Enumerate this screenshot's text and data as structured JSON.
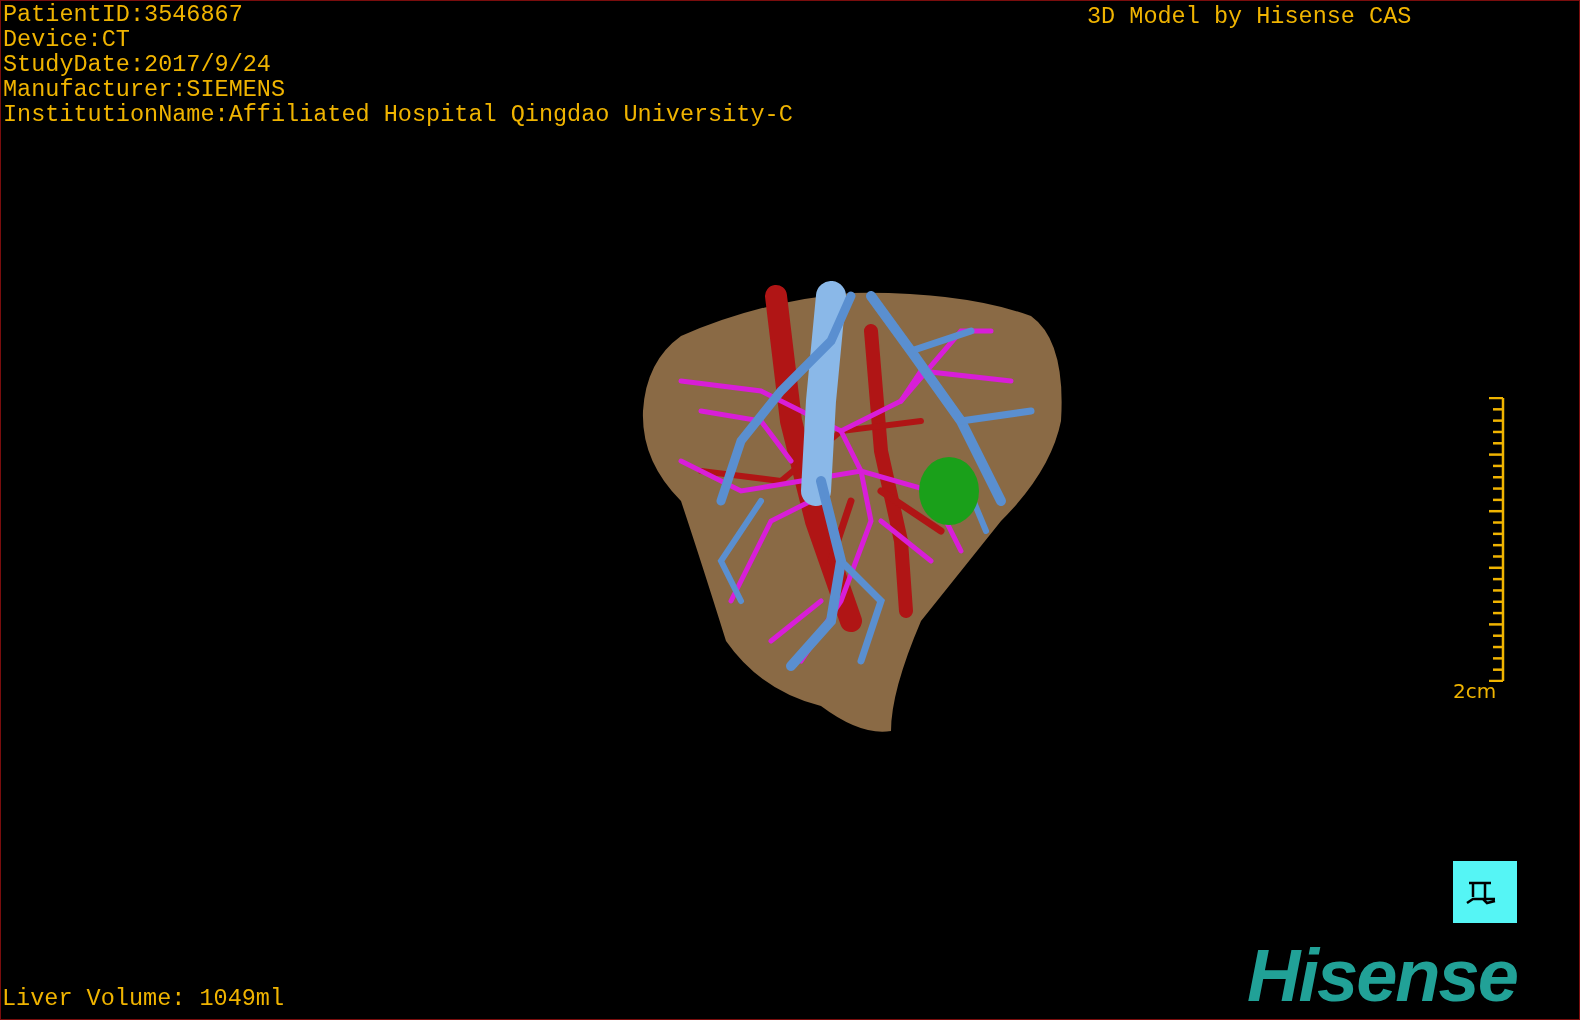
{
  "info_lines": [
    "PatientID:3546867",
    "Device:CT",
    "StudyDate:2017/9/24",
    "Manufacturer:SIEMENS",
    "InstitutionName:Affiliated Hospital Qingdao University-C"
  ],
  "model_title": "3D Model by Hisense CAS",
  "scale_bar": {
    "label": "2cm"
  },
  "liver_volume": "Liver Volume: 1049ml",
  "logo": "Hisense"
}
